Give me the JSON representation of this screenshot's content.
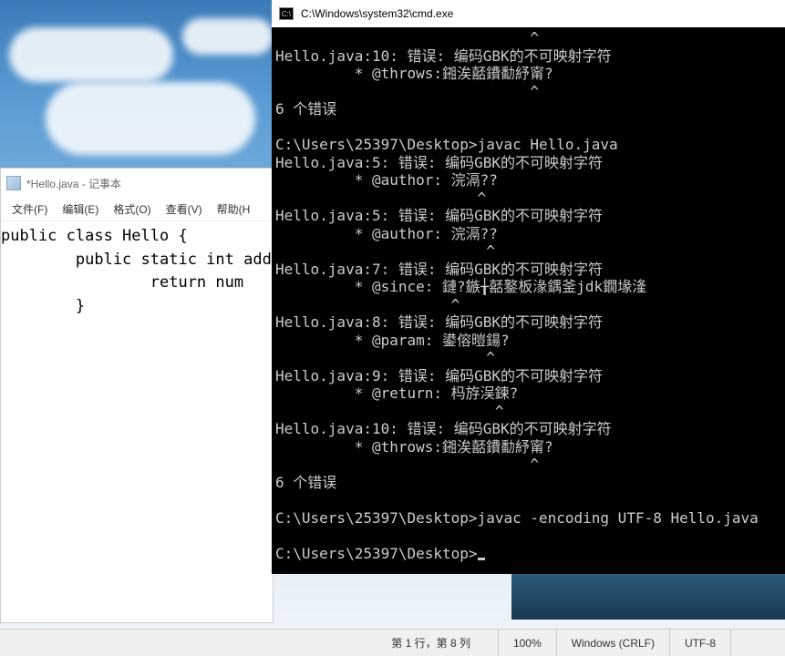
{
  "notepad": {
    "title": "*Hello.java - 记事本",
    "menu": {
      "file": "文件(F)",
      "edit": "编辑(E)",
      "format": "格式(O)",
      "view": "查看(V)",
      "help": "帮助(H"
    },
    "content": "public class Hello {\n        public static int add(in\n                return num\n        }"
  },
  "status": {
    "pos": "第 1 行，第 8 列",
    "zoom": "100%",
    "eol": "Windows (CRLF)",
    "encoding": "UTF-8"
  },
  "cmd": {
    "title": "C:\\Windows\\system32\\cmd.exe",
    "lines": [
      "                             ^",
      "Hello.java:10: 错误: 编码GBK的不可映射字符",
      "         * @throws:鎺涘嚭鐨勫紓甯?",
      "                             ^",
      "6 个错误",
      "",
      "C:\\Users\\25397\\Desktop>javac Hello.java",
      "Hello.java:5: 错误: 编码GBK的不可映射字符",
      "         * @author: 浣滆??",
      "                       ^",
      "Hello.java:5: 错误: 编码GBK的不可映射字符",
      "         * @author: 浣滆??",
      "                        ^",
      "Hello.java:7: 错误: 编码GBK的不可映射字符",
      "         * @since: 鏈?鏃╁嚭鐜板湪鍝釜jdk鐗堟湰",
      "                    ^",
      "Hello.java:8: 错误: 编码GBK的不可映射字符",
      "         * @param: 鍙傛暟鍚?",
      "                        ^",
      "Hello.java:9: 错误: 编码GBK的不可映射字符",
      "         * @return: 杩斿洖鍊?",
      "                         ^",
      "Hello.java:10: 错误: 编码GBK的不可映射字符",
      "         * @throws:鎺涘嚭鐨勫紓甯?",
      "                             ^",
      "6 个错误",
      "",
      "C:\\Users\\25397\\Desktop>javac -encoding UTF-8 Hello.java",
      "",
      "C:\\Users\\25397\\Desktop>"
    ]
  }
}
